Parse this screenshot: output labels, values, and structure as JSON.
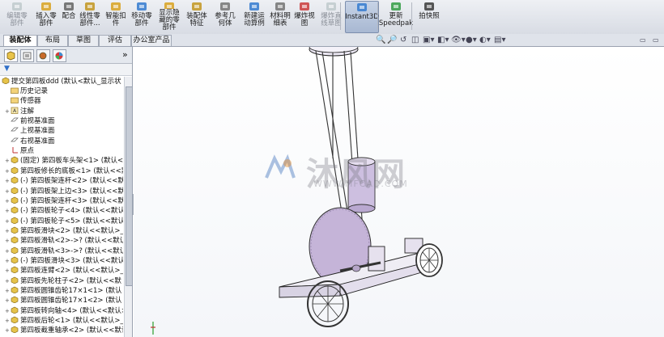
{
  "ribbon": {
    "buttons": [
      {
        "id": "edit-component",
        "label": "编辑零\n部件",
        "disabled": true
      },
      {
        "id": "insert-component",
        "label": "插入零\n部件",
        "disabled": false
      },
      {
        "id": "mate",
        "label": "配合",
        "disabled": false
      },
      {
        "id": "linear-pattern",
        "label": "线性零\n部件...",
        "disabled": false
      },
      {
        "id": "smart-fastener",
        "label": "智能扣\n件",
        "disabled": false
      },
      {
        "id": "move-component",
        "label": "移动零\n部件",
        "disabled": false
      },
      {
        "id": "show-hidden",
        "label": "显示隐\n藏的零\n部件",
        "disabled": false
      },
      {
        "id": "assembly-feature",
        "label": "装配体\n特征",
        "disabled": false
      },
      {
        "id": "reference-geometry",
        "label": "参考几\n何体",
        "disabled": false
      },
      {
        "id": "new-motion-study",
        "label": "新建运\n动算例",
        "disabled": false
      },
      {
        "id": "bom",
        "label": "材料明\n细表",
        "disabled": false
      },
      {
        "id": "exploded-view",
        "label": "爆炸视\n图",
        "disabled": false
      },
      {
        "id": "explode-line-sketch",
        "label": "爆炸直\n线草图",
        "disabled": true
      },
      {
        "id": "instant3d",
        "label": "Instant3D",
        "disabled": false,
        "active": true
      },
      {
        "id": "update-speedpak",
        "label": "更新\nSpeedpak",
        "disabled": false
      },
      {
        "id": "snapshot",
        "label": "拍快照",
        "disabled": false
      }
    ]
  },
  "tabs": [
    {
      "label": "装配体",
      "active": true
    },
    {
      "label": "布局",
      "active": false
    },
    {
      "label": "草图",
      "active": false
    },
    {
      "label": "评估",
      "active": false
    },
    {
      "label": "办公室产品",
      "active": false
    }
  ],
  "panel": {
    "expand_glyph": "»",
    "filter_glyph": "▼"
  },
  "tree": {
    "root": "提交第四板ddd  (默认<默认_显示状",
    "items": [
      {
        "label": "历史记录",
        "icon": "folder-icon",
        "expander": ""
      },
      {
        "label": "传感器",
        "icon": "sensor-icon",
        "expander": ""
      },
      {
        "label": "注解",
        "icon": "annotation-icon",
        "expander": "+"
      },
      {
        "label": "前视基准面",
        "icon": "plane-icon",
        "expander": ""
      },
      {
        "label": "上视基准面",
        "icon": "plane-icon",
        "expander": ""
      },
      {
        "label": "右视基准面",
        "icon": "plane-icon",
        "expander": ""
      },
      {
        "label": "原点",
        "icon": "origin-icon",
        "expander": ""
      },
      {
        "label": "(固定) 第四板车头架<1> (默认<",
        "icon": "part-icon",
        "expander": "+"
      },
      {
        "label": "第四板修长的底板<1> (默认<<默",
        "icon": "part-icon",
        "expander": "+"
      },
      {
        "label": "(-) 第四板架连杆<2> (默认<<默",
        "icon": "part-icon",
        "expander": "+"
      },
      {
        "label": "(-) 第四板架上边<3> (默认<<默",
        "icon": "part-icon",
        "expander": "+"
      },
      {
        "label": "(-) 第四板架连杆<3> (默认<<默",
        "icon": "part-icon",
        "expander": "+"
      },
      {
        "label": "(-) 第四板轮子<4> (默认<<默认",
        "icon": "part-icon",
        "expander": "+"
      },
      {
        "label": "(-) 第四板轮子<5> (默认<<默认",
        "icon": "part-icon",
        "expander": "+"
      },
      {
        "label": "第四板滑块<2> (默认<<默认>_显",
        "icon": "part-icon",
        "expander": "+"
      },
      {
        "label": "第四板滑轨<2>->? (默认<<默认",
        "icon": "part-icon",
        "expander": "+"
      },
      {
        "label": "第四板滑轨<3>->? (默认<<默认",
        "icon": "part-icon",
        "expander": "+"
      },
      {
        "label": "(-) 第四板滑块<3> (默认<<默认",
        "icon": "part-icon",
        "expander": "+"
      },
      {
        "label": "第四板连臂<2> (默认<<默认>_显",
        "icon": "part-icon",
        "expander": "+"
      },
      {
        "label": "第四板先轮柱子<2> (默认<<默",
        "icon": "part-icon",
        "expander": "+"
      },
      {
        "label": "第四板圆锥齿轮17×1<1> (默认",
        "icon": "part-icon",
        "expander": "+"
      },
      {
        "label": "第四板圆锥齿轮17×1<2> (默认",
        "icon": "part-icon",
        "expander": "+"
      },
      {
        "label": "第四板转向轴<4> (默认<<默认>",
        "icon": "part-icon",
        "expander": "+"
      },
      {
        "label": "第四板后轮<1> (默认<<默认>_显",
        "icon": "part-icon",
        "expander": "+"
      },
      {
        "label": "第四板截重轴承<2> (默认<<默认",
        "icon": "part-icon",
        "expander": "+"
      }
    ]
  },
  "viewport": {
    "watermark": "沐风网",
    "watermark_url": "WWW.MFCAD.COM"
  },
  "colors": {
    "accent": "#2f6fc8",
    "part_yellow": "#e6c34a",
    "blade": "#c5b4d8",
    "cylinder": "#cdbfe0"
  }
}
